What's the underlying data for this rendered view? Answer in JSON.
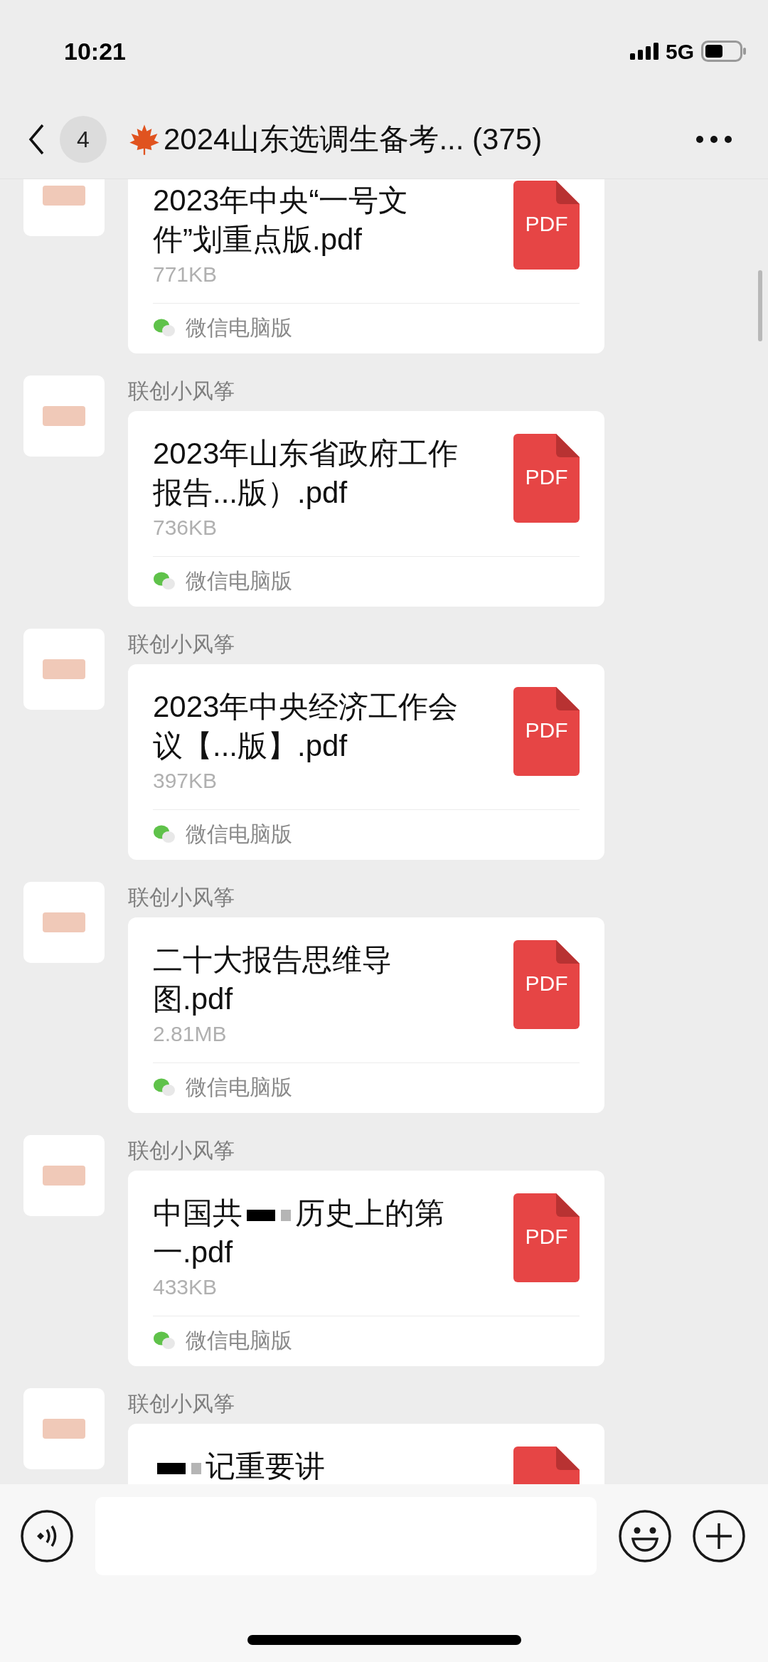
{
  "status_bar": {
    "time": "10:21",
    "network": "5G"
  },
  "header": {
    "back_badge": "4",
    "title": "2024山东选调生备考... (375)"
  },
  "messages": [
    {
      "title_parts": [
        {
          "kind": "text",
          "text": "2023年中央“一号文件”划重点版.pdf"
        }
      ],
      "file_type": "PDF",
      "size": "771KB",
      "source": "微信电脑版"
    },
    {
      "sender": "联创小风筝",
      "title_parts": [
        {
          "kind": "text",
          "text": "2023年山东省政府工作报告...版）.pdf"
        }
      ],
      "file_type": "PDF",
      "size": "736KB",
      "source": "微信电脑版"
    },
    {
      "sender": "联创小风筝",
      "title_parts": [
        {
          "kind": "text",
          "text": "2023年中央经济工作会议【...版】.pdf"
        }
      ],
      "file_type": "PDF",
      "size": "397KB",
      "source": "微信电脑版"
    },
    {
      "sender": "联创小风筝",
      "title_parts": [
        {
          "kind": "text",
          "text": "二十大报告思维导图.pdf"
        }
      ],
      "file_type": "PDF",
      "size": "2.81MB",
      "source": "微信电脑版"
    },
    {
      "sender": "联创小风筝",
      "title_parts": [
        {
          "kind": "text",
          "text": "中国共"
        },
        {
          "kind": "redaction"
        },
        {
          "kind": "text",
          "text": "历史上的第一.pdf"
        }
      ],
      "file_type": "PDF",
      "size": "433KB",
      "source": "微信电脑版"
    },
    {
      "sender": "联创小风筝",
      "title_parts": [
        {
          "kind": "redaction"
        },
        {
          "kind": "text",
          "text": "记重要讲"
        }
      ]
    }
  ]
}
